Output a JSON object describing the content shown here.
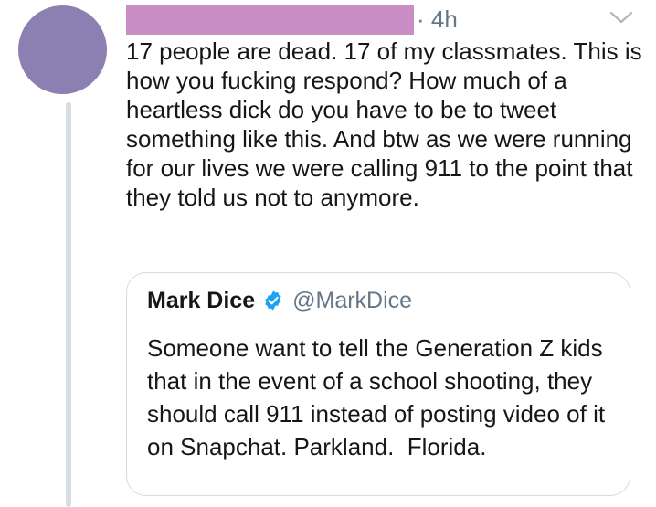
{
  "tweet": {
    "time": "· 4h",
    "text": "17 people are dead. 17 of my classmates. This is how you fucking respond? How much of a heartless dick do you have to be to tweet something like this. And btw as we were running for our lives we were calling 911 to the point that they told us not to anymore."
  },
  "quoted_tweet": {
    "name": "Mark Dice",
    "handle": "@MarkDice",
    "text": "Someone want to tell the Generation Z kids that in the event of a school shooting, they should call 911 instead of posting video of it on Snapchat. Parkland.  Florida."
  },
  "icons": {
    "verified": "verified-badge-icon",
    "menu": "chevron-down-icon"
  },
  "colors": {
    "avatar": "#8c7fb2",
    "redaction": "#c98ec4",
    "verified_blue": "#1da1f2",
    "secondary_text": "#657786",
    "thread_line": "#d6dde3"
  }
}
